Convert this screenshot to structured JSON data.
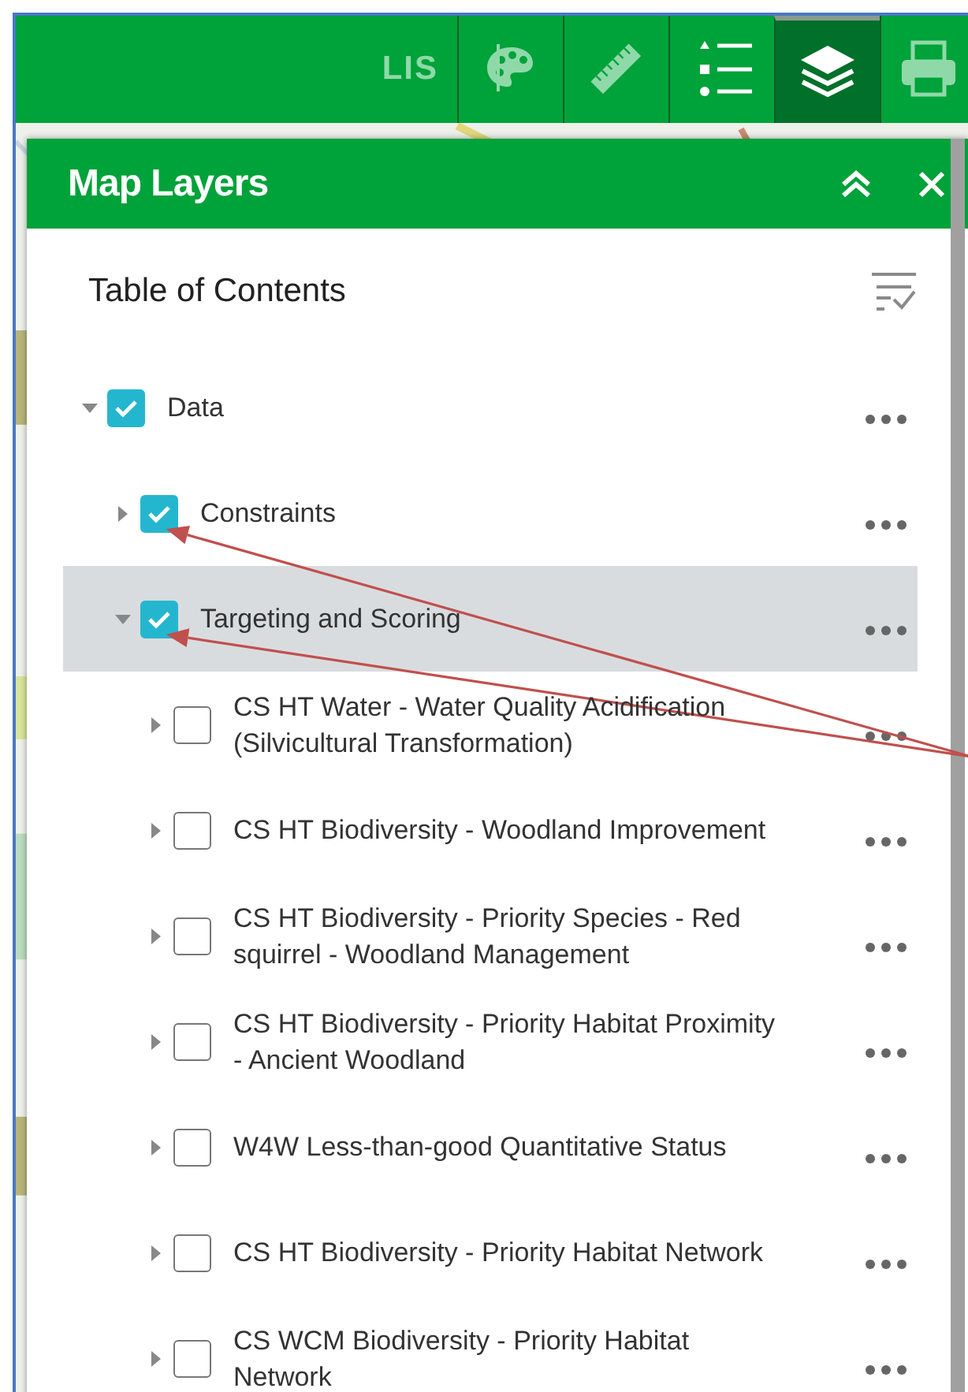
{
  "toolbar": {
    "label": "LIS",
    "tools": [
      {
        "kind": "palette",
        "selected": false
      },
      {
        "kind": "ruler",
        "selected": false
      },
      {
        "kind": "legend",
        "selected": false
      },
      {
        "kind": "layers",
        "selected": true
      },
      {
        "kind": "printer",
        "selected": false
      }
    ]
  },
  "panel": {
    "title": "Map Layers",
    "subtitle": "Table of Contents",
    "layers": [
      {
        "label": "Data",
        "checked": true,
        "expanded": true,
        "selected": false,
        "pointed_at": false,
        "children": [
          {
            "label": "Constraints",
            "checked": true,
            "expanded": false,
            "selected": false,
            "pointed_at": true
          },
          {
            "label": "Targeting and Scoring",
            "checked": true,
            "expanded": true,
            "selected": true,
            "pointed_at": true,
            "children": [
              {
                "label": "CS HT Water - Water Quality Acidification (Silvicultural Transformation)",
                "checked": false,
                "expanded": false,
                "selected": false,
                "pointed_at": false
              },
              {
                "label": "CS HT Biodiversity - Woodland Improvement",
                "checked": false,
                "expanded": false,
                "selected": false,
                "pointed_at": false
              },
              {
                "label": "CS HT Biodiversity - Priority Species - Red squirrel - Woodland Management",
                "checked": false,
                "expanded": false,
                "selected": false,
                "pointed_at": false
              },
              {
                "label": "CS HT Biodiversity - Priority Habitat Proximity - Ancient Woodland",
                "checked": false,
                "expanded": false,
                "selected": false,
                "pointed_at": false
              },
              {
                "label": "W4W Less-than-good Quantitative Status",
                "checked": false,
                "expanded": false,
                "selected": false,
                "pointed_at": false
              },
              {
                "label": "CS HT Biodiversity - Priority Habitat Network",
                "checked": false,
                "expanded": false,
                "selected": false,
                "pointed_at": false
              },
              {
                "label": "CS WCM Biodiversity - Priority Habitat Network",
                "checked": false,
                "expanded": false,
                "selected": false,
                "pointed_at": false
              }
            ]
          }
        ]
      }
    ]
  }
}
